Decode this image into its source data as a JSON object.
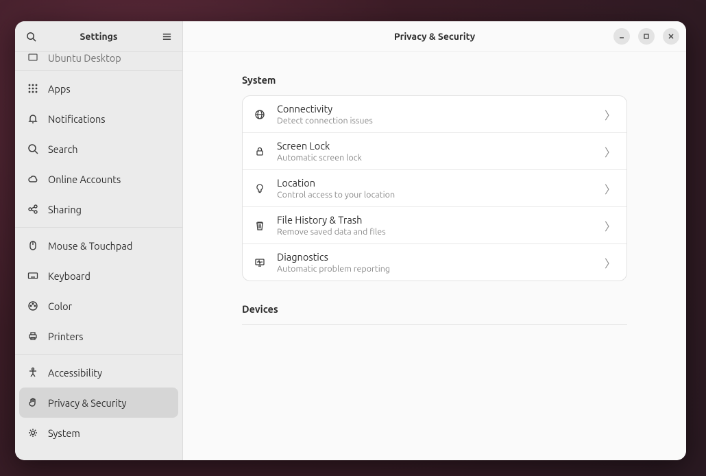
{
  "sidebar": {
    "title": "Settings",
    "items": [
      {
        "label": "Ubuntu Desktop"
      },
      {
        "label": "Apps"
      },
      {
        "label": "Notifications"
      },
      {
        "label": "Search"
      },
      {
        "label": "Online Accounts"
      },
      {
        "label": "Sharing"
      },
      {
        "label": "Mouse & Touchpad"
      },
      {
        "label": "Keyboard"
      },
      {
        "label": "Color"
      },
      {
        "label": "Printers"
      },
      {
        "label": "Accessibility"
      },
      {
        "label": "Privacy & Security"
      },
      {
        "label": "System"
      }
    ]
  },
  "main": {
    "title": "Privacy & Security",
    "sections": {
      "system": {
        "title": "System",
        "rows": [
          {
            "title": "Connectivity",
            "sub": "Detect connection issues"
          },
          {
            "title": "Screen Lock",
            "sub": "Automatic screen lock"
          },
          {
            "title": "Location",
            "sub": "Control access to your location"
          },
          {
            "title": "File History & Trash",
            "sub": "Remove saved data and files"
          },
          {
            "title": "Diagnostics",
            "sub": "Automatic problem reporting"
          }
        ]
      },
      "devices": {
        "title": "Devices"
      }
    }
  }
}
